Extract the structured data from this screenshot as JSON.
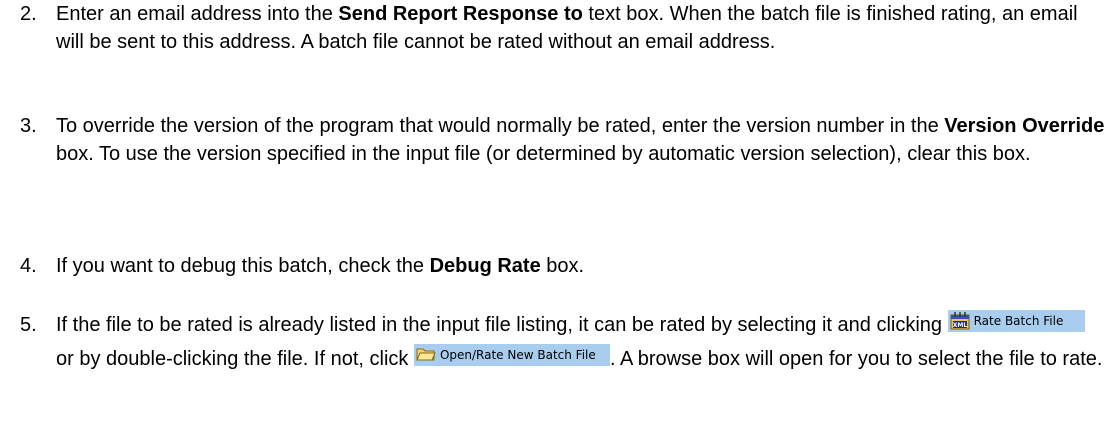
{
  "steps": [
    {
      "number": "2.",
      "before": "Enter an email address into the ",
      "bold": "Send Report Response to",
      "after": " text box. When the batch file is finished rating, an email will be sent to this address. A batch file cannot be rated without an email address."
    },
    {
      "number": "3.",
      "before": "To override the version of the program that would normally be rated, enter the version number in the ",
      "bold": "Version Override",
      "after": " box. To use the version specified in the input file (or determined by automatic version selection), clear this box."
    },
    {
      "number": "4.",
      "before": "If you want to debug this batch, check the ",
      "bold": "Debug Rate",
      "after": " box."
    },
    {
      "number": "5.",
      "text_1": "If the file to be rated is already listed in the input file listing, it can be rated by selecting it and clicking ",
      "text_2": " or by double-clicking the file. If not, click ",
      "text_3": ". A browse box will open for you to select the file to rate."
    }
  ],
  "buttons": {
    "rate_batch": {
      "label": "Rate Batch File",
      "icon": "xml-calendar-icon",
      "icon_label": "XML",
      "bg": "#a9cdee"
    },
    "open_rate_new": {
      "label": "Open/Rate New Batch File",
      "icon": "folder-icon",
      "bg": "#a9cdee"
    }
  }
}
